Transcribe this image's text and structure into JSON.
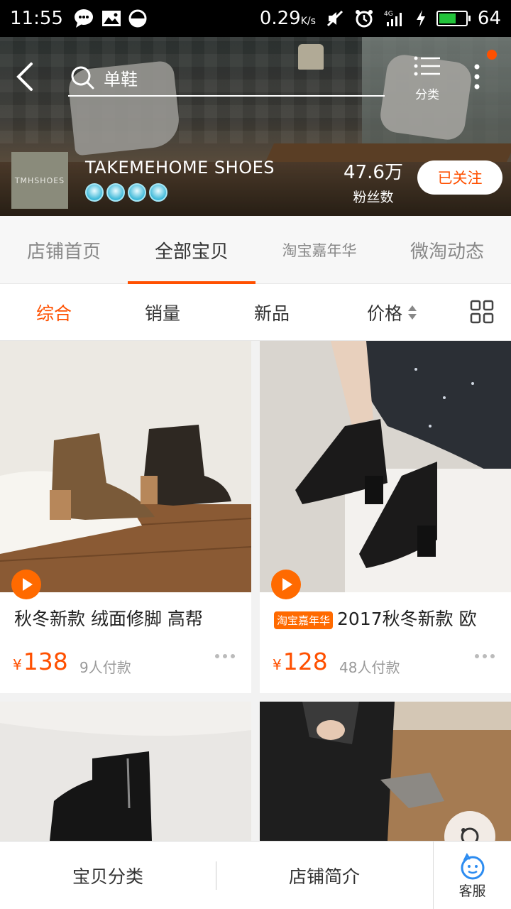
{
  "status_bar": {
    "time": "11:55",
    "net_speed": "0.29",
    "net_unit": "K/s",
    "battery": "64",
    "battery_color": "#22c33a"
  },
  "header": {
    "search_text": "单鞋",
    "category_label": "分类",
    "accent_dot_color": "#ff5000"
  },
  "shop": {
    "logo_text": "TMHSHOES",
    "name": "TAKEMEHOME SHOES",
    "crown_count": 4,
    "fans_count": "47.6万",
    "fans_label": "粉丝数",
    "follow_label": "已关注"
  },
  "tabs": [
    {
      "label": "店铺首页",
      "active": false
    },
    {
      "label": "全部宝贝",
      "active": true
    },
    {
      "label": "淘宝嘉年华",
      "active": false
    },
    {
      "label": "微淘动态",
      "active": false
    }
  ],
  "sort": {
    "items": [
      "综合",
      "销量",
      "新品",
      "价格"
    ],
    "active_index": 0
  },
  "products": [
    {
      "title": "秋冬新款 绒面修脚 高帮",
      "tag": "",
      "currency": "¥",
      "price": "138",
      "sold": "9人付款"
    },
    {
      "title": "2017秋冬新款 欧",
      "tag": "淘宝嘉年华",
      "currency": "¥",
      "price": "128",
      "sold": "48人付款"
    },
    {
      "title": "",
      "tag": "",
      "currency": "",
      "price": "",
      "sold": ""
    },
    {
      "title": "",
      "tag": "",
      "currency": "",
      "price": "",
      "sold": ""
    }
  ],
  "bottom_bar": {
    "category": "宝贝分类",
    "intro": "店铺简介",
    "service": "客服"
  },
  "colors": {
    "accent": "#ff5000",
    "price": "#ff5000",
    "tag_bg": "#ff6a00"
  }
}
